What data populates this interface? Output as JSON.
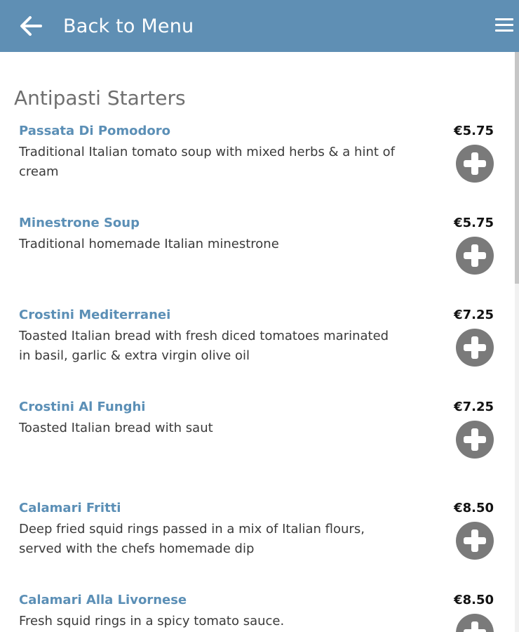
{
  "header": {
    "back_label": "Back to Menu",
    "back_icon": "arrow-left-icon",
    "menu_icon": "hamburger-menu-icon",
    "background_color": "#5f8fb4"
  },
  "section": {
    "title": "Antipasti Starters"
  },
  "items": [
    {
      "name": "Passata Di Pomodoro",
      "description": "Traditional Italian tomato soup with mixed herbs & a hint of cream",
      "price": "€5.75"
    },
    {
      "name": "Minestrone Soup",
      "description": "Traditional homemade Italian minestrone",
      "price": "€5.75"
    },
    {
      "name": "Crostini Mediterranei",
      "description": "Toasted Italian bread with fresh diced tomatoes marinated in basil, garlic & extra virgin olive oil",
      "price": "€7.25"
    },
    {
      "name": "Crostini Al Funghi",
      "description": "Toasted Italian bread with saut",
      "price": "€7.25"
    },
    {
      "name": "Calamari Fritti",
      "description": "Deep fried squid rings passed in a mix of Italian flours, served with the chefs homemade dip",
      "price": "€8.50"
    },
    {
      "name": "Calamari Alla Livornese",
      "description": "Fresh squid rings in a spicy tomato sauce.",
      "price": "€8.50"
    }
  ],
  "colors": {
    "item_name": "#5b8fb6",
    "add_button": "#7a7a7a",
    "section_title": "#6f6f6f"
  }
}
